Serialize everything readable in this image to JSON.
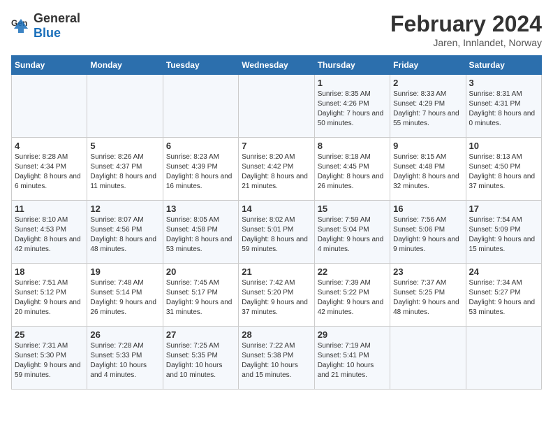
{
  "logo": {
    "text_general": "General",
    "text_blue": "Blue"
  },
  "title": "February 2024",
  "subtitle": "Jaren, Innlandet, Norway",
  "headers": [
    "Sunday",
    "Monday",
    "Tuesday",
    "Wednesday",
    "Thursday",
    "Friday",
    "Saturday"
  ],
  "weeks": [
    [
      {
        "day": "",
        "info": ""
      },
      {
        "day": "",
        "info": ""
      },
      {
        "day": "",
        "info": ""
      },
      {
        "day": "",
        "info": ""
      },
      {
        "day": "1",
        "info": "Sunrise: 8:35 AM\nSunset: 4:26 PM\nDaylight: 7 hours\nand 50 minutes."
      },
      {
        "day": "2",
        "info": "Sunrise: 8:33 AM\nSunset: 4:29 PM\nDaylight: 7 hours\nand 55 minutes."
      },
      {
        "day": "3",
        "info": "Sunrise: 8:31 AM\nSunset: 4:31 PM\nDaylight: 8 hours\nand 0 minutes."
      }
    ],
    [
      {
        "day": "4",
        "info": "Sunrise: 8:28 AM\nSunset: 4:34 PM\nDaylight: 8 hours\nand 6 minutes."
      },
      {
        "day": "5",
        "info": "Sunrise: 8:26 AM\nSunset: 4:37 PM\nDaylight: 8 hours\nand 11 minutes."
      },
      {
        "day": "6",
        "info": "Sunrise: 8:23 AM\nSunset: 4:39 PM\nDaylight: 8 hours\nand 16 minutes."
      },
      {
        "day": "7",
        "info": "Sunrise: 8:20 AM\nSunset: 4:42 PM\nDaylight: 8 hours\nand 21 minutes."
      },
      {
        "day": "8",
        "info": "Sunrise: 8:18 AM\nSunset: 4:45 PM\nDaylight: 8 hours\nand 26 minutes."
      },
      {
        "day": "9",
        "info": "Sunrise: 8:15 AM\nSunset: 4:48 PM\nDaylight: 8 hours\nand 32 minutes."
      },
      {
        "day": "10",
        "info": "Sunrise: 8:13 AM\nSunset: 4:50 PM\nDaylight: 8 hours\nand 37 minutes."
      }
    ],
    [
      {
        "day": "11",
        "info": "Sunrise: 8:10 AM\nSunset: 4:53 PM\nDaylight: 8 hours\nand 42 minutes."
      },
      {
        "day": "12",
        "info": "Sunrise: 8:07 AM\nSunset: 4:56 PM\nDaylight: 8 hours\nand 48 minutes."
      },
      {
        "day": "13",
        "info": "Sunrise: 8:05 AM\nSunset: 4:58 PM\nDaylight: 8 hours\nand 53 minutes."
      },
      {
        "day": "14",
        "info": "Sunrise: 8:02 AM\nSunset: 5:01 PM\nDaylight: 8 hours\nand 59 minutes."
      },
      {
        "day": "15",
        "info": "Sunrise: 7:59 AM\nSunset: 5:04 PM\nDaylight: 9 hours\nand 4 minutes."
      },
      {
        "day": "16",
        "info": "Sunrise: 7:56 AM\nSunset: 5:06 PM\nDaylight: 9 hours\nand 9 minutes."
      },
      {
        "day": "17",
        "info": "Sunrise: 7:54 AM\nSunset: 5:09 PM\nDaylight: 9 hours\nand 15 minutes."
      }
    ],
    [
      {
        "day": "18",
        "info": "Sunrise: 7:51 AM\nSunset: 5:12 PM\nDaylight: 9 hours\nand 20 minutes."
      },
      {
        "day": "19",
        "info": "Sunrise: 7:48 AM\nSunset: 5:14 PM\nDaylight: 9 hours\nand 26 minutes."
      },
      {
        "day": "20",
        "info": "Sunrise: 7:45 AM\nSunset: 5:17 PM\nDaylight: 9 hours\nand 31 minutes."
      },
      {
        "day": "21",
        "info": "Sunrise: 7:42 AM\nSunset: 5:20 PM\nDaylight: 9 hours\nand 37 minutes."
      },
      {
        "day": "22",
        "info": "Sunrise: 7:39 AM\nSunset: 5:22 PM\nDaylight: 9 hours\nand 42 minutes."
      },
      {
        "day": "23",
        "info": "Sunrise: 7:37 AM\nSunset: 5:25 PM\nDaylight: 9 hours\nand 48 minutes."
      },
      {
        "day": "24",
        "info": "Sunrise: 7:34 AM\nSunset: 5:27 PM\nDaylight: 9 hours\nand 53 minutes."
      }
    ],
    [
      {
        "day": "25",
        "info": "Sunrise: 7:31 AM\nSunset: 5:30 PM\nDaylight: 9 hours\nand 59 minutes."
      },
      {
        "day": "26",
        "info": "Sunrise: 7:28 AM\nSunset: 5:33 PM\nDaylight: 10 hours\nand 4 minutes."
      },
      {
        "day": "27",
        "info": "Sunrise: 7:25 AM\nSunset: 5:35 PM\nDaylight: 10 hours\nand 10 minutes."
      },
      {
        "day": "28",
        "info": "Sunrise: 7:22 AM\nSunset: 5:38 PM\nDaylight: 10 hours\nand 15 minutes."
      },
      {
        "day": "29",
        "info": "Sunrise: 7:19 AM\nSunset: 5:41 PM\nDaylight: 10 hours\nand 21 minutes."
      },
      {
        "day": "",
        "info": ""
      },
      {
        "day": "",
        "info": ""
      }
    ]
  ]
}
